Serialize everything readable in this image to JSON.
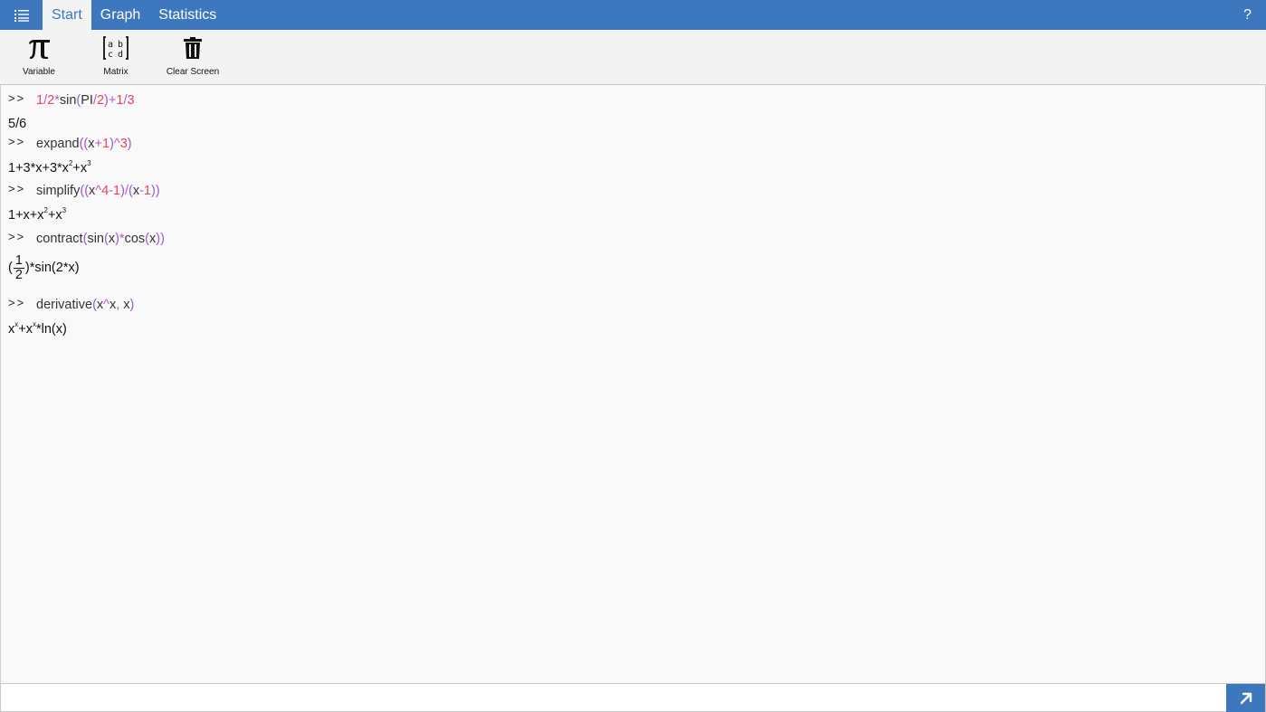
{
  "topbar": {
    "menu_icon": "list-icon",
    "tabs": [
      {
        "label": "Start",
        "active": true
      },
      {
        "label": "Graph",
        "active": false
      },
      {
        "label": "Statistics",
        "active": false
      }
    ],
    "help_label": "?"
  },
  "ribbon": {
    "variable_label": "Variable",
    "matrix_label": "Matrix",
    "clear_label": "Clear Screen"
  },
  "console": {
    "prompt": ">>",
    "entries": [
      {
        "command": "1/2*sin(PI/2)+1/3",
        "result": "5/6"
      },
      {
        "command": "expand((x+1)^3)",
        "result": "1+3*x+3*x^2+x^3"
      },
      {
        "command": "simplify((x^4-1)/(x-1))",
        "result": "1+x+x^2+x^3"
      },
      {
        "command": "contract(sin(x)*cos(x))",
        "result": "(1/2)*sin(2*x)"
      },
      {
        "command": "derivative(x^x, x)",
        "result": "x^x+x^x*ln(x)"
      }
    ]
  },
  "input": {
    "value": "",
    "placeholder": ""
  },
  "colors": {
    "accent": "#3d78bf",
    "number": "#e8435a",
    "operator": "#c055c8",
    "paren": "#9b59d0"
  }
}
